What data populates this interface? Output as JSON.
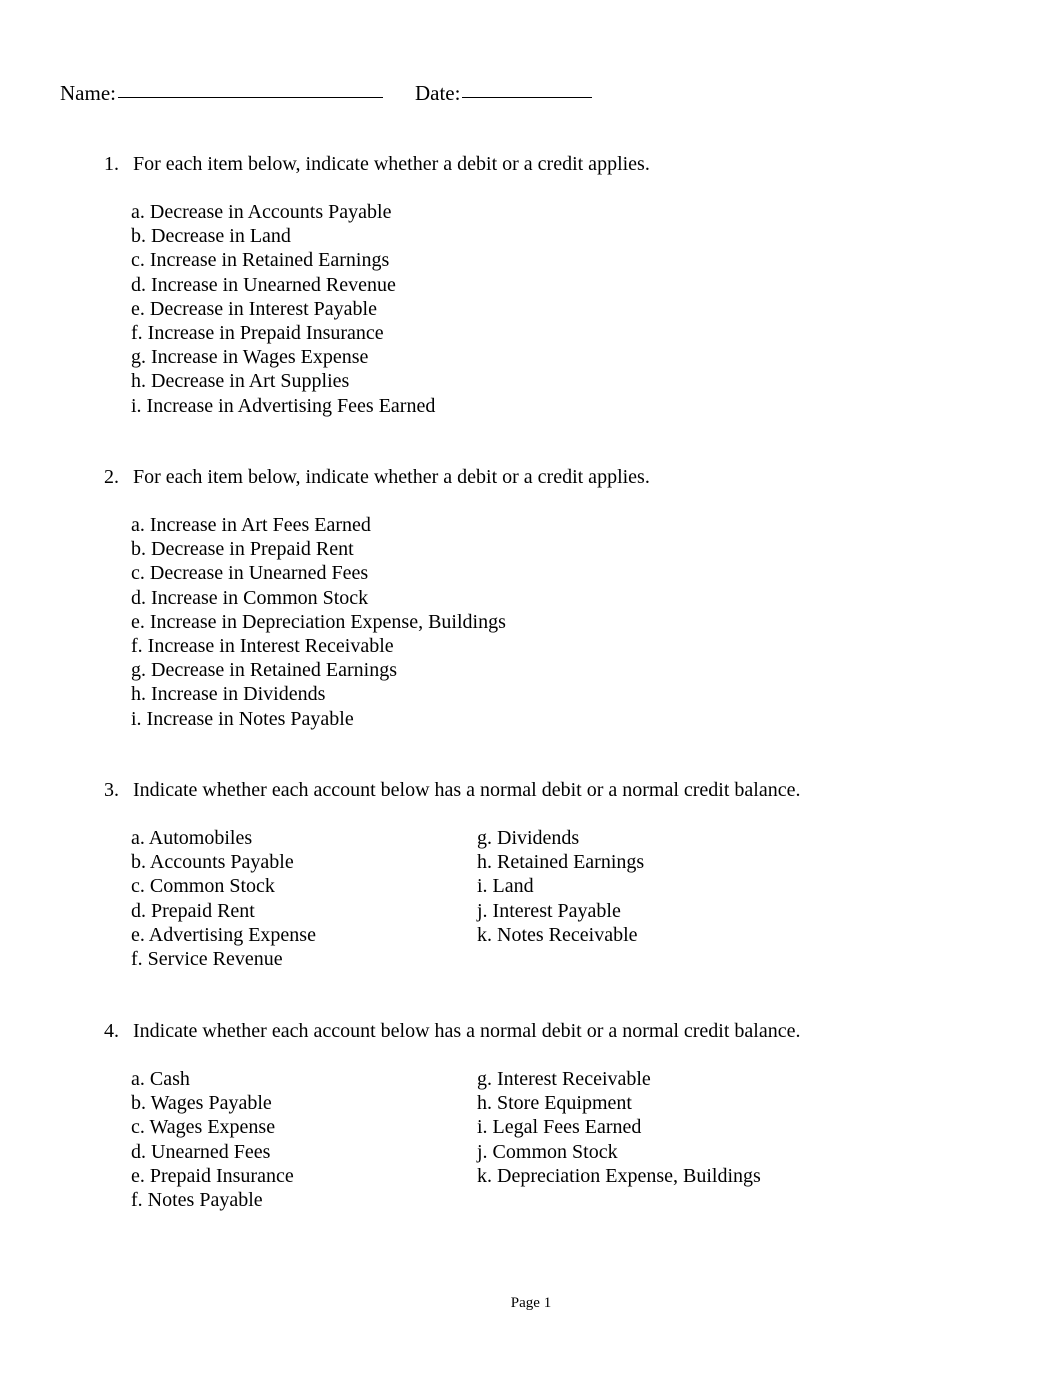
{
  "header": {
    "name_label": "Name:",
    "date_label": "Date:"
  },
  "questions": [
    {
      "number": "1.",
      "prompt": "For each item below, indicate whether a debit or a credit applies.",
      "layout": "single",
      "items": [
        "a. Decrease in Accounts Payable",
        "b. Decrease in Land",
        "c. Increase in Retained Earnings",
        "d. Increase in Unearned Revenue",
        "e. Decrease in Interest Payable",
        "f. Increase in Prepaid Insurance",
        "g. Increase in Wages Expense",
        "h. Decrease in Art Supplies",
        "i. Increase in Advertising Fees Earned"
      ]
    },
    {
      "number": "2.",
      "prompt": "For each item below, indicate whether a debit or a credit applies.",
      "layout": "single",
      "items": [
        "a. Increase in Art Fees Earned",
        "b. Decrease in Prepaid Rent",
        "c. Decrease in Unearned Fees",
        "d. Increase in Common Stock",
        "e. Increase in Depreciation Expense, Buildings",
        "f. Increase in Interest Receivable",
        "g. Decrease in Retained Earnings",
        "h. Increase in Dividends",
        "i. Increase in Notes Payable"
      ]
    },
    {
      "number": "3.",
      "prompt": "Indicate whether each account below has a normal debit or a normal credit balance.",
      "layout": "two-column",
      "left_items": [
        "a. Automobiles",
        "b. Accounts Payable",
        "c. Common Stock",
        "d. Prepaid Rent",
        "e. Advertising Expense",
        "f. Service Revenue"
      ],
      "right_items": [
        "g. Dividends",
        "h. Retained Earnings",
        "i. Land",
        "j. Interest Payable",
        "k. Notes Receivable"
      ]
    },
    {
      "number": "4.",
      "prompt": "Indicate whether each account below has a normal debit or a normal credit balance.",
      "layout": "two-column",
      "left_items": [
        "a. Cash",
        "b. Wages Payable",
        "c. Wages Expense",
        "d. Unearned Fees",
        "e. Prepaid Insurance",
        "f. Notes Payable"
      ],
      "right_items": [
        "g. Interest Receivable",
        "h. Store Equipment",
        "i. Legal Fees Earned",
        "j. Common Stock",
        "k. Depreciation Expense, Buildings"
      ]
    }
  ],
  "footer": {
    "page_label": "Page 1"
  }
}
